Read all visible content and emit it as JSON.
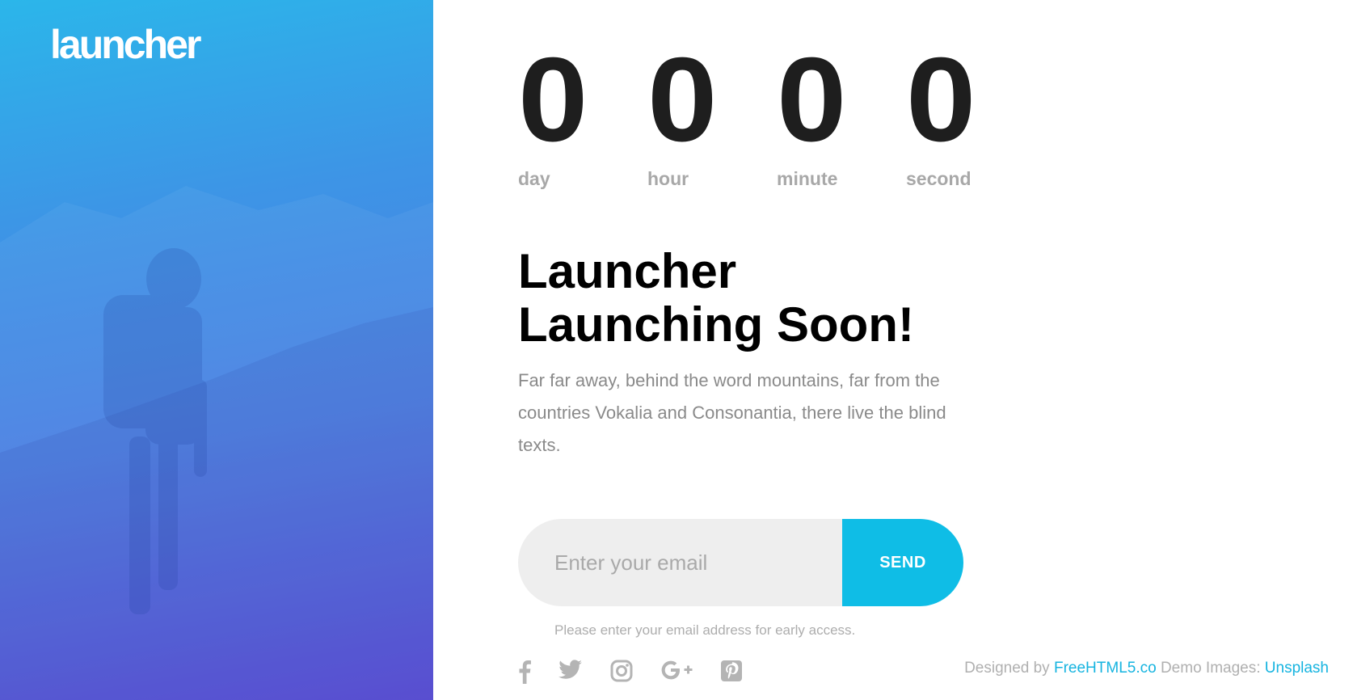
{
  "brand": {
    "logo": "launcher"
  },
  "countdown": [
    {
      "value": "0",
      "label": "day"
    },
    {
      "value": "0",
      "label": "hour"
    },
    {
      "value": "0",
      "label": "minute"
    },
    {
      "value": "0",
      "label": "second"
    }
  ],
  "headline": {
    "line1": "Launcher",
    "line2": "Launching Soon!",
    "description": "Far far away, behind the word mountains, far from the countries Vokalia and Consonantia, there live the blind texts."
  },
  "subscribe": {
    "email_placeholder": "Enter your email",
    "email_value": "",
    "send_label": "SEND",
    "hint": "Please enter your email address for early access."
  },
  "social": [
    "facebook-icon",
    "twitter-icon",
    "instagram-icon",
    "google-plus-icon",
    "pinterest-icon"
  ],
  "footer": {
    "designed_by": "Designed by",
    "designer_link": "FreeHTML5.co",
    "demo_images": "Demo Images:",
    "images_link": "Unsplash"
  },
  "colors": {
    "accent": "#0fbde6",
    "gradient_top": "#2bb6ea",
    "gradient_bottom": "#5848d6",
    "countdown_digit": "#1e1e1e",
    "muted_text": "#8a8a8a",
    "link": "#16b4e0"
  }
}
